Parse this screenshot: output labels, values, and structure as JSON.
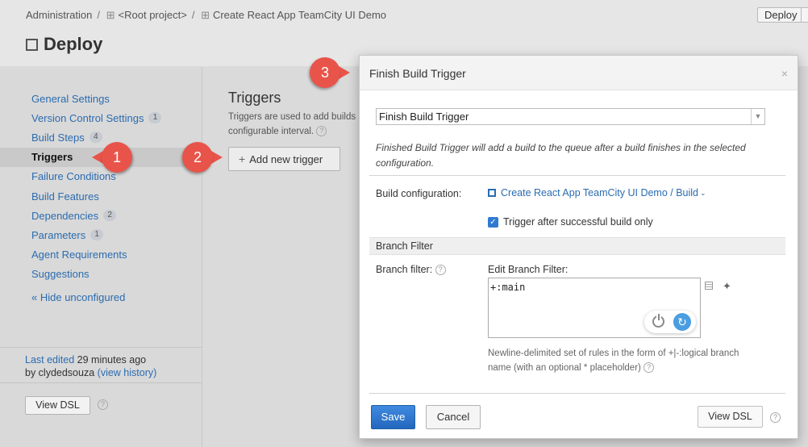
{
  "breadcrumb": {
    "items": [
      "Administration",
      "<Root project>",
      "Create React App TeamCity UI Demo"
    ],
    "separator": "/",
    "deploy_button": "Deploy"
  },
  "page": {
    "title": "Deploy"
  },
  "sidebar": {
    "items": [
      {
        "label": "General Settings",
        "badge": ""
      },
      {
        "label": "Version Control Settings",
        "badge": "1"
      },
      {
        "label": "Build Steps",
        "badge": "4"
      },
      {
        "label": "Triggers",
        "badge": "",
        "active": true
      },
      {
        "label": "Failure Conditions",
        "badge": ""
      },
      {
        "label": "Build Features",
        "badge": ""
      },
      {
        "label": "Dependencies",
        "badge": "2"
      },
      {
        "label": "Parameters",
        "badge": "1"
      },
      {
        "label": "Agent Requirements",
        "badge": ""
      },
      {
        "label": "Suggestions",
        "badge": ""
      }
    ],
    "hide_unconfigured": "« Hide unconfigured",
    "last_edited_link": "Last edited",
    "last_edited_time": "29 minutes ago",
    "last_edited_by": "by clydedsouza",
    "view_history": "(view history)",
    "view_dsl": "View DSL"
  },
  "main": {
    "title": "Triggers",
    "desc_line1": "Triggers are used to add builds",
    "desc_line2": "configurable interval.",
    "add_trigger": "Add new trigger"
  },
  "callouts": [
    "1",
    "2",
    "3"
  ],
  "dialog": {
    "title": "Finish Build Trigger",
    "close": "×",
    "trigger_type_selected": "Finish Build Trigger",
    "description": "Finished Build Trigger will add a build to the queue after a build finishes in the selected configuration.",
    "build_config_label": "Build configuration:",
    "build_config_value": "Create React App TeamCity UI Demo / Build",
    "checkbox_label": "Trigger after successful build only",
    "branch_section": "Branch Filter",
    "branch_filter_label": "Branch filter:",
    "edit_branch_filter_label": "Edit Branch Filter:",
    "branch_filter_value": "+:main",
    "hint": "Newline-delimited set of rules in the form of +|-:logical branch name (with an optional * placeholder)",
    "save": "Save",
    "cancel": "Cancel",
    "view_dsl": "View DSL"
  },
  "colors": {
    "accent": "#2f7bd3",
    "link": "#2b6cb0",
    "callout": "#e8544a"
  }
}
